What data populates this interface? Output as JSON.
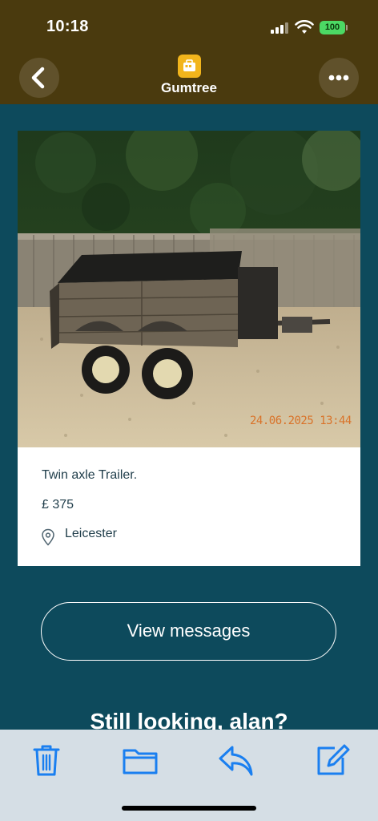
{
  "status_bar": {
    "time": "10:18",
    "battery": "100"
  },
  "nav": {
    "title": "Gumtree"
  },
  "listing": {
    "photo_stamp": "24.06.2025 13:44",
    "title": "Twin axle Trailer.",
    "price": "£ 375",
    "location": "Leicester"
  },
  "actions": {
    "view_messages": "View messages"
  },
  "footer_heading": "Still looking, alan?",
  "colors": {
    "header": "#4a3a0e",
    "page_bg": "#0d4a5c",
    "toolbar_bg": "#d5dee5",
    "toolbar_icon": "#1a7ff0",
    "brand_yellow": "#f2b51c",
    "battery_green": "#4cd964"
  },
  "icons": [
    "back-chevron-icon",
    "more-dots-icon",
    "gumtree-logo-icon",
    "location-pin-icon",
    "trash-icon",
    "folder-icon",
    "reply-icon",
    "compose-icon",
    "wifi-icon",
    "signal-icon"
  ]
}
